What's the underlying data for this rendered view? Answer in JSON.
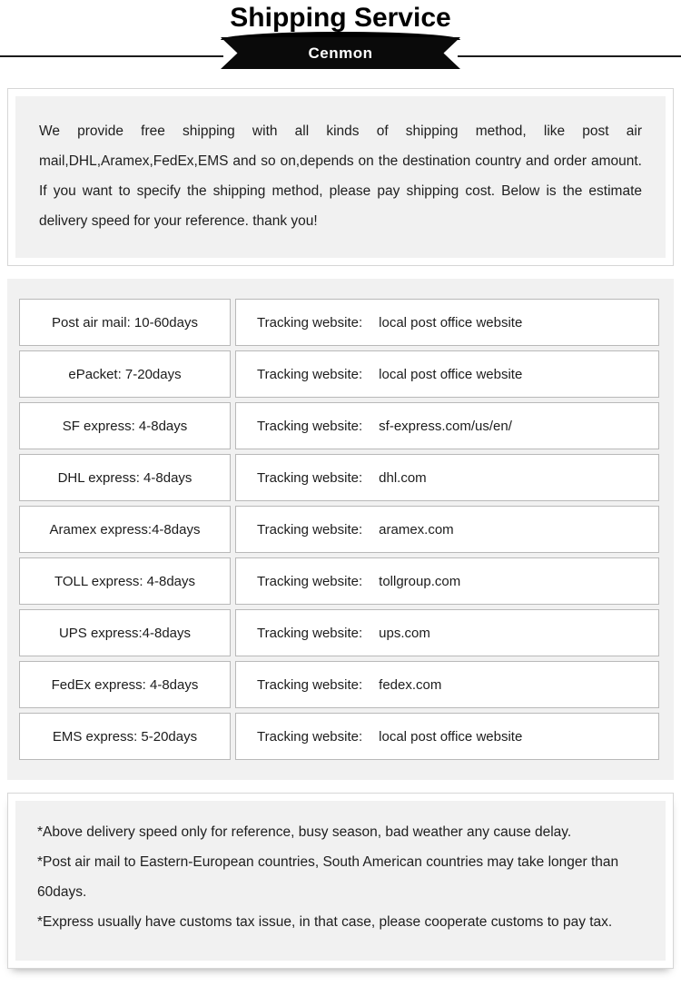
{
  "header": {
    "title": "Shipping Service",
    "ribbon_label": "Cenmon"
  },
  "intro": {
    "text": "We provide free shipping with all kinds of shipping method, like post air mail,DHL,Aramex,FedEx,EMS and so on,depends on the destination country and order amount. If you want to specify the shipping method, please pay shipping cost. Below is the estimate delivery speed for your reference. thank you!"
  },
  "shipping_table": {
    "tracking_label": "Tracking website:",
    "rows": [
      {
        "method": "Post air mail: 10-60days",
        "tracking_label": "Tracking website:",
        "tracking_value": "local post office website"
      },
      {
        "method": "ePacket: 7-20days",
        "tracking_label": "Tracking website:",
        "tracking_value": "local post office website"
      },
      {
        "method": "SF express: 4-8days",
        "tracking_label": "Tracking website:",
        "tracking_value": "sf-express.com/us/en/"
      },
      {
        "method": "DHL express: 4-8days",
        "tracking_label": "Tracking website:",
        "tracking_value": "dhl.com"
      },
      {
        "method": "Aramex express:4-8days",
        "tracking_label": "Tracking website:",
        "tracking_value": "aramex.com"
      },
      {
        "method": "TOLL express: 4-8days",
        "tracking_label": "Tracking website:",
        "tracking_value": "tollgroup.com"
      },
      {
        "method": "UPS express:4-8days",
        "tracking_label": "Tracking website:",
        "tracking_value": "ups.com"
      },
      {
        "method": "FedEx express: 4-8days",
        "tracking_label": "Tracking website:",
        "tracking_value": "fedex.com"
      },
      {
        "method": "EMS express: 5-20days",
        "tracking_label": "Tracking website:",
        "tracking_value": "local post office website"
      }
    ]
  },
  "notes": {
    "lines": [
      "*Above delivery speed only for reference, busy season, bad weather any cause delay.",
      "*Post air mail to Eastern-European countries, South American countries may take longer than 60days.",
      "*Express usually have customs tax issue, in that case, please cooperate customs to pay tax."
    ]
  },
  "colors": {
    "ribbon": "#0a0a0a",
    "panel_bg": "#f1f1f1",
    "cell_border": "#b9b9b9",
    "text": "#1e1e1e"
  }
}
